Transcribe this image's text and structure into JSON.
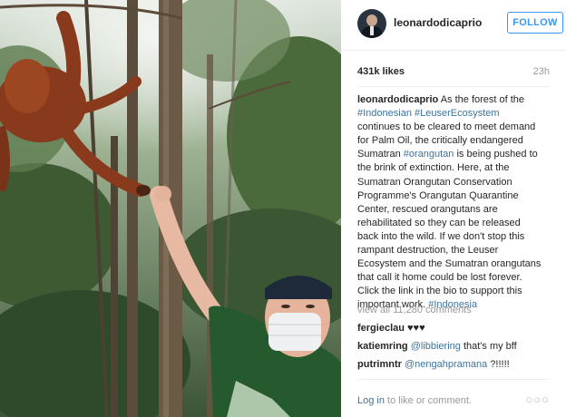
{
  "profile": {
    "username": "leonardodicaprio",
    "follow_label": "FOLLOW"
  },
  "stats": {
    "likes": "431k likes",
    "time": "23h"
  },
  "caption": {
    "username": "leonardodicaprio",
    "lines": [
      " As the forest of the",
      "#Indonesian #LeuserEcosystem",
      "continues to be cleared to meet demand",
      "for Palm Oil, the critically endangered",
      "Sumatran #orangutan is being pushed to",
      "the brink of extinction. Here, at the",
      "Sumatran Orangutan Conservation",
      "Programme's Orangutan Quarantine",
      "Center, rescued orangutans are",
      "rehabilitated so they can be released",
      "back into the wild. If we don't stop this",
      "rampant destruction, the Leuser",
      "Ecosystem and the Sumatran orangutans",
      "that call it home could be lost forever.",
      "Click the link in the bio to support this",
      "important work. #Indonesia"
    ],
    "hashtags": {
      "indonesian": "#Indonesian",
      "leuser": "#LeuserEcosystem",
      "orangutan": "#orangutan",
      "indonesia": "#Indonesia"
    }
  },
  "comments": {
    "view_all": "view all 11,280 comments",
    "items": [
      {
        "user": "fergieclau",
        "mention": "",
        "text": " ♥♥♥"
      },
      {
        "user": "katiemring",
        "mention": "@libbiering",
        "text": " that's my bff"
      },
      {
        "user": "putrimntr",
        "mention": "@nengahpramana",
        "text": " ?!!!!!"
      }
    ]
  },
  "footer": {
    "login_link": "Log in",
    "login_rest": " to like or comment.",
    "more_icon": "more-options-icon",
    "more_glyph": "○○○"
  },
  "colors": {
    "accent": "#3897f0",
    "link": "#3f729b",
    "muted": "#999999",
    "text": "#262626"
  }
}
